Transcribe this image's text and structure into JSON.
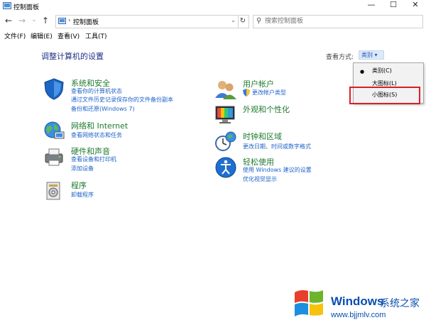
{
  "window": {
    "title": "控制面板",
    "minimize": "—",
    "maximize": "☐",
    "close": "✕"
  },
  "nav": {
    "back": "←",
    "forward": "→",
    "recent": "⌄",
    "up": "↑",
    "refresh": "↻"
  },
  "address": {
    "separator": "›",
    "path": "控制面板",
    "dropdown": "⌄"
  },
  "search": {
    "placeholder": "搜索控制面板"
  },
  "menu": [
    "文件(F)",
    "编辑(E)",
    "查看(V)",
    "工具(T)"
  ],
  "main": {
    "title": "调整计算机的设置",
    "view_by_label": "查看方式:",
    "view_by_value": "类别 ▾"
  },
  "categories": {
    "system": {
      "title": "系统和安全",
      "links": [
        "查看你的计算机状态",
        "通过文件历史记录保存你的文件备份副本",
        "备份和还原(Windows 7)"
      ]
    },
    "network": {
      "title": "网络和 Internet",
      "links": [
        "查看网络状态和任务"
      ]
    },
    "hardware": {
      "title": "硬件和声音",
      "links": [
        "查看设备和打印机",
        "添加设备"
      ]
    },
    "programs": {
      "title": "程序",
      "links": [
        "卸载程序"
      ]
    },
    "user": {
      "title": "用户帐户",
      "links": [
        "更改帐户类型"
      ]
    },
    "appearance": {
      "title": "外观和个性化",
      "links": []
    },
    "clock": {
      "title": "时钟和区域",
      "links": [
        "更改日期、时间或数字格式"
      ]
    },
    "ease": {
      "title": "轻松使用",
      "links": [
        "使用 Windows 建议的设置",
        "优化视觉显示"
      ]
    }
  },
  "dropdown": {
    "options": [
      "类别(C)",
      "大图标(L)",
      "小图标(S)"
    ],
    "selected_bullet": "●"
  },
  "watermark": {
    "brand": "Windows",
    "brand_cn": "系统之家",
    "url": "www.bjjmlv.com"
  },
  "colors": {
    "link": "#1e62c9",
    "category_title": "#1f7a2f",
    "page_title": "#1e3287",
    "highlight": "#d81f26",
    "watermark": "#0a4fae"
  }
}
